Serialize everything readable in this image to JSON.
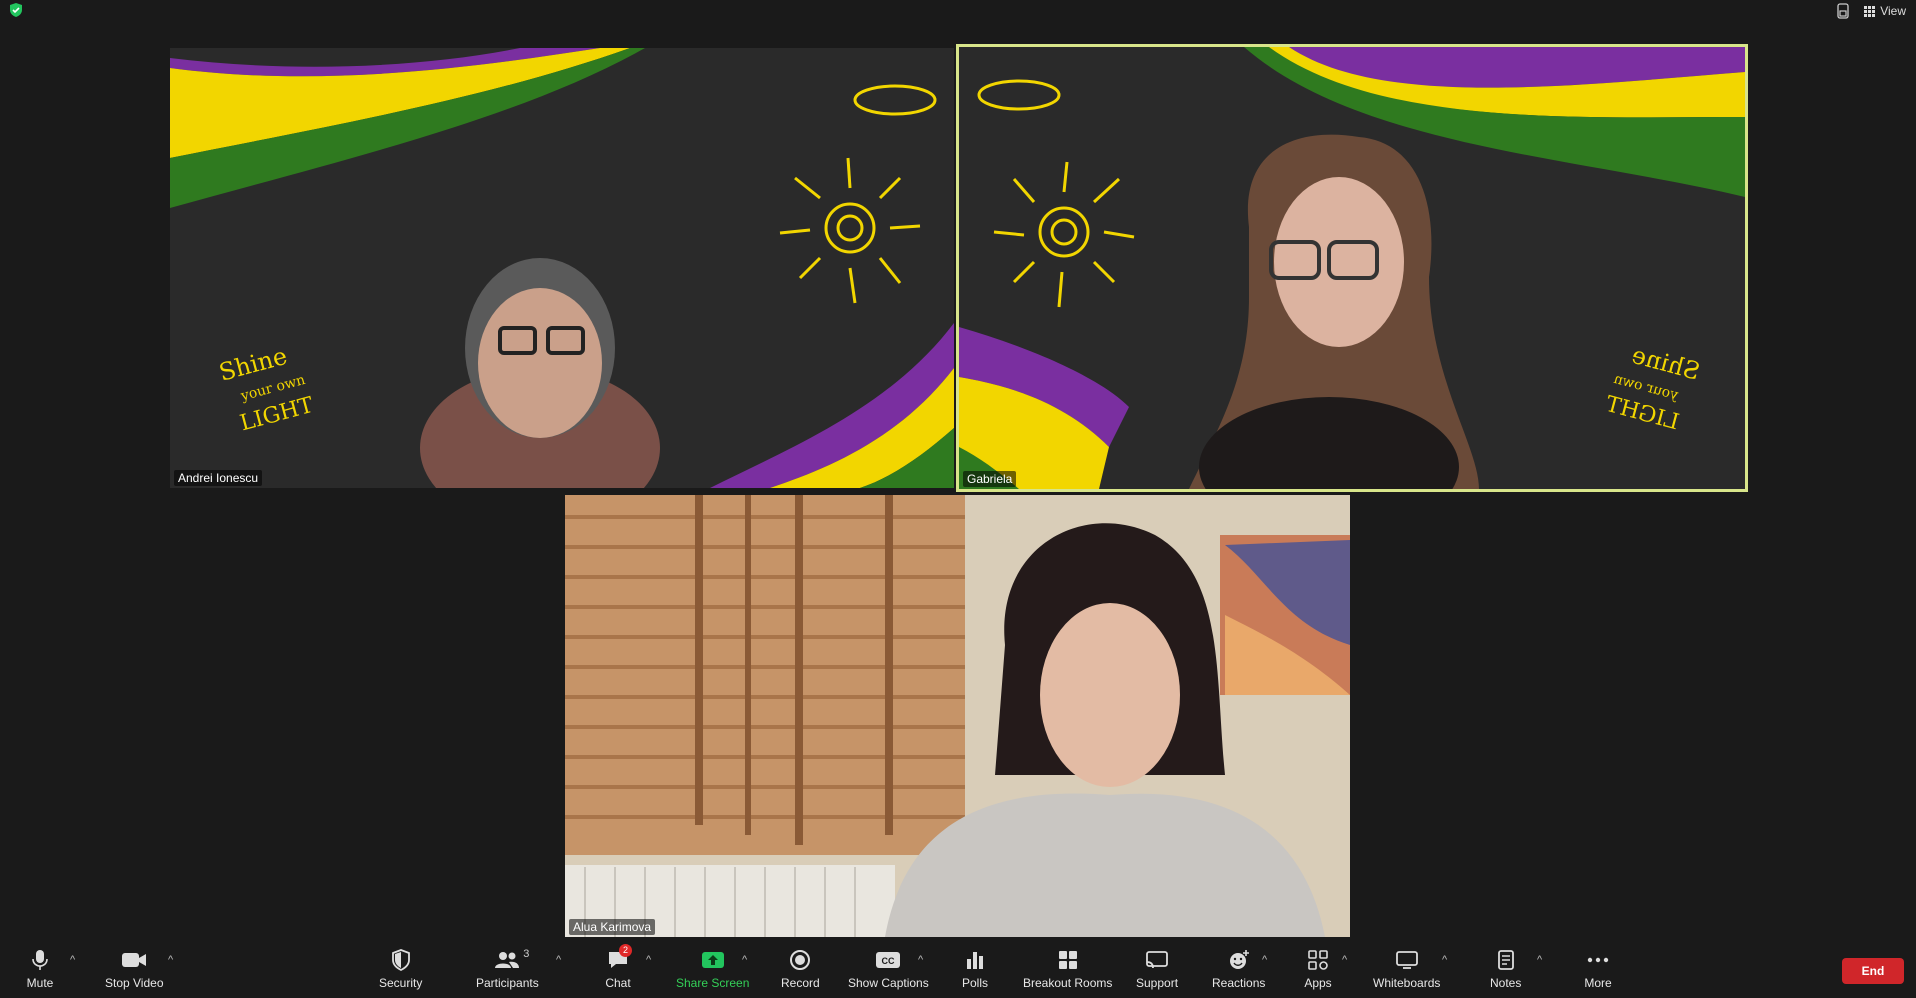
{
  "topbar": {
    "view_label": "View"
  },
  "participants": [
    {
      "name": "Andrei Ionescu"
    },
    {
      "name": "Gabriela"
    },
    {
      "name": "Alua Karimova"
    }
  ],
  "toolbar": {
    "mute": "Mute",
    "stop_video": "Stop Video",
    "security": "Security",
    "participants": "Participants",
    "participants_count": "3",
    "chat": "Chat",
    "chat_badge": "2",
    "share_screen": "Share Screen",
    "record": "Record",
    "show_captions": "Show Captions",
    "polls": "Polls",
    "breakout_rooms": "Breakout Rooms",
    "support": "Support",
    "reactions": "Reactions",
    "apps": "Apps",
    "whiteboards": "Whiteboards",
    "notes": "Notes",
    "more": "More",
    "end": "End"
  },
  "colors": {
    "share_green": "#22c55e",
    "end_red": "#d0262a",
    "active_border": "#d8e58a"
  }
}
